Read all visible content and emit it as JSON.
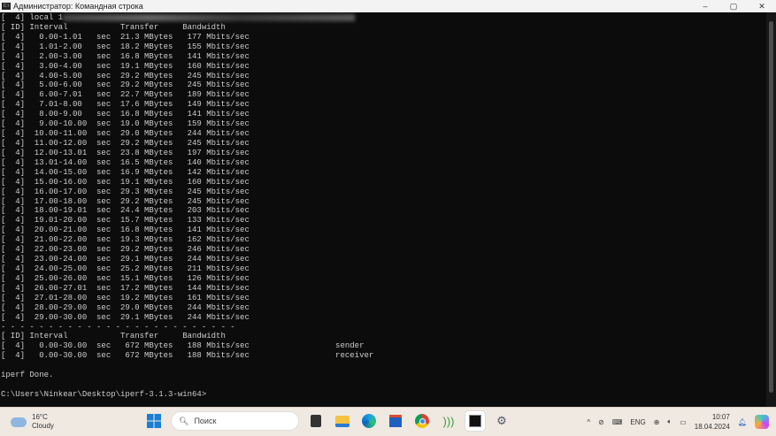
{
  "window": {
    "title": "Администратор: Командная строка",
    "icon_label": "C:\\",
    "minimize": "–",
    "maximize": "▢",
    "close": "✕"
  },
  "terminal": {
    "first_line_prefix": "[  4] local 1",
    "lines": [
      "[ ID] Interval           Transfer     Bandwidth",
      "[  4]   0.00-1.01   sec  21.3 MBytes   177 Mbits/sec",
      "[  4]   1.01-2.00   sec  18.2 MBytes   155 Mbits/sec",
      "[  4]   2.00-3.00   sec  16.8 MBytes   141 Mbits/sec",
      "[  4]   3.00-4.00   sec  19.1 MBytes   160 Mbits/sec",
      "[  4]   4.00-5.00   sec  29.2 MBytes   245 Mbits/sec",
      "[  4]   5.00-6.00   sec  29.2 MBytes   245 Mbits/sec",
      "[  4]   6.00-7.01   sec  22.7 MBytes   189 Mbits/sec",
      "[  4]   7.01-8.00   sec  17.6 MBytes   149 Mbits/sec",
      "[  4]   8.00-9.00   sec  16.8 MBytes   141 Mbits/sec",
      "[  4]   9.00-10.00  sec  19.0 MBytes   159 Mbits/sec",
      "[  4]  10.00-11.00  sec  29.0 MBytes   244 Mbits/sec",
      "[  4]  11.00-12.00  sec  29.2 MBytes   245 Mbits/sec",
      "[  4]  12.00-13.01  sec  23.8 MBytes   197 Mbits/sec",
      "[  4]  13.01-14.00  sec  16.5 MBytes   140 Mbits/sec",
      "[  4]  14.00-15.00  sec  16.9 MBytes   142 Mbits/sec",
      "[  4]  15.00-16.00  sec  19.1 MBytes   160 Mbits/sec",
      "[  4]  16.00-17.00  sec  29.3 MBytes   245 Mbits/sec",
      "[  4]  17.00-18.00  sec  29.2 MBytes   245 Mbits/sec",
      "[  4]  18.00-19.01  sec  24.4 MBytes   203 Mbits/sec",
      "[  4]  19.01-20.00  sec  15.7 MBytes   133 Mbits/sec",
      "[  4]  20.00-21.00  sec  16.8 MBytes   141 Mbits/sec",
      "[  4]  21.00-22.00  sec  19.3 MBytes   162 Mbits/sec",
      "[  4]  22.00-23.00  sec  29.2 MBytes   246 Mbits/sec",
      "[  4]  23.00-24.00  sec  29.1 MBytes   244 Mbits/sec",
      "[  4]  24.00-25.00  sec  25.2 MBytes   211 Mbits/sec",
      "[  4]  25.00-26.00  sec  15.1 MBytes   126 Mbits/sec",
      "[  4]  26.00-27.01  sec  17.2 MBytes   144 Mbits/sec",
      "[  4]  27.01-28.00  sec  19.2 MBytes   161 Mbits/sec",
      "[  4]  28.00-29.00  sec  29.0 MBytes   244 Mbits/sec",
      "[  4]  29.00-30.00  sec  29.1 MBytes   244 Mbits/sec",
      "- - - - - - - - - - - - - - - - - - - - - - - - -",
      "[ ID] Interval           Transfer     Bandwidth",
      "[  4]   0.00-30.00  sec   672 MBytes   188 Mbits/sec                  sender",
      "[  4]   0.00-30.00  sec   672 MBytes   188 Mbits/sec                  receiver",
      "",
      "iperf Done.",
      "",
      "C:\\Users\\Ninkear\\Desktop\\iperf-3.1.3-win64>"
    ]
  },
  "taskbar": {
    "temp": "16°C",
    "weather": "Cloudy",
    "search_placeholder": "Поиск",
    "lang": "ENG",
    "time": "10:07",
    "date": "18.04.2024"
  }
}
